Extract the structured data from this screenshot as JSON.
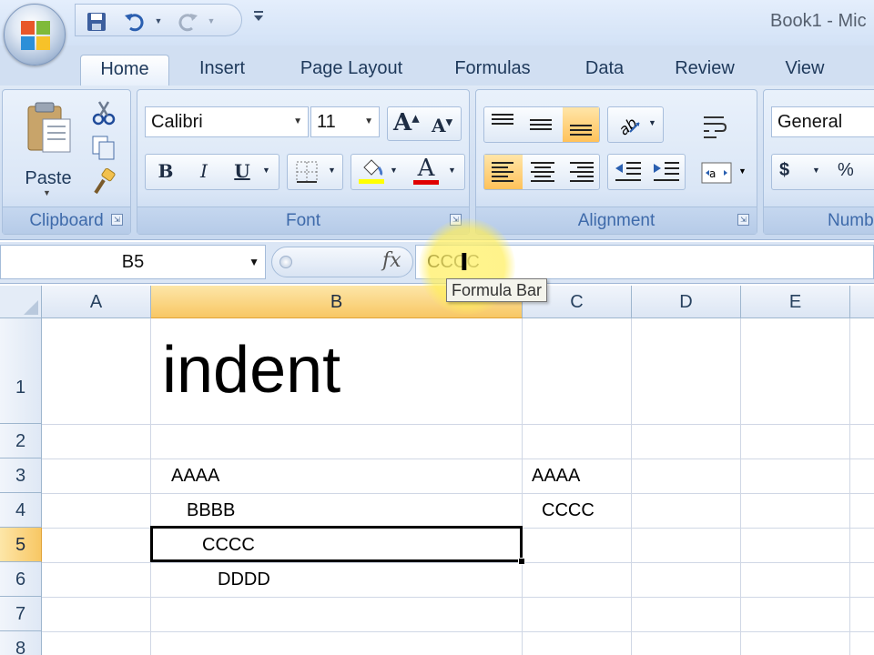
{
  "window": {
    "title": "Book1 - Mic"
  },
  "colors": {
    "ribbon_label": "#3e6aaa",
    "selected_header": "#f8c764",
    "font_color_bar": "#e00000",
    "highlight_bar": "#ffff00"
  },
  "quick_access": {
    "icons": [
      "save-icon",
      "undo-icon",
      "redo-icon",
      "customize-icon"
    ]
  },
  "tabs": [
    {
      "label": "Home",
      "active": true
    },
    {
      "label": "Insert"
    },
    {
      "label": "Page Layout"
    },
    {
      "label": "Formulas"
    },
    {
      "label": "Data"
    },
    {
      "label": "Review"
    },
    {
      "label": "View"
    }
  ],
  "ribbon": {
    "clipboard": {
      "label": "Clipboard",
      "paste_label": "Paste"
    },
    "font": {
      "label": "Font",
      "font_name": "Calibri",
      "font_size": "11",
      "bold": "B",
      "italic": "I",
      "underline": "U",
      "font_color_glyph": "A"
    },
    "alignment": {
      "label": "Alignment"
    },
    "number": {
      "label": "Numb",
      "format": "General",
      "currency": "$",
      "percent": "%"
    }
  },
  "formula_bar": {
    "name_box": "B5",
    "fx": "fx",
    "content": "CCCC",
    "tooltip": "Formula Bar"
  },
  "sheet": {
    "columns": [
      "A",
      "B",
      "C",
      "D",
      "E"
    ],
    "selected_column": "B",
    "rows": [
      "1",
      "2",
      "3",
      "4",
      "5",
      "6",
      "7",
      "8"
    ],
    "selected_row": "5",
    "active_cell": "B5",
    "cells": {
      "B1": "indent",
      "B3": "AAAA",
      "B4": "BBBB",
      "B5": "CCCC",
      "B6": "DDDD",
      "C3": "AAAA",
      "C4": "CCCC"
    }
  }
}
